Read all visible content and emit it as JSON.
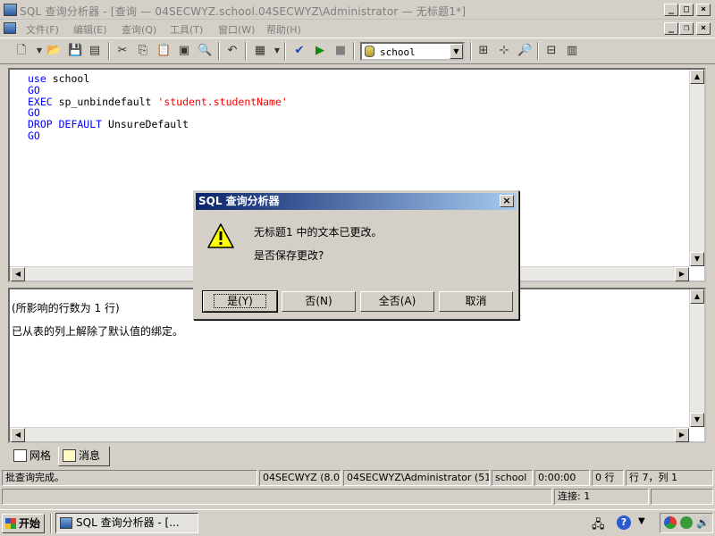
{
  "window": {
    "title": "SQL 查询分析器 - [查询 — 04SECWYZ.school.04SECWYZ\\Administrator — 无标题1*]",
    "min": "_",
    "max": "□",
    "close": "×"
  },
  "menu": {
    "items": [
      "文件(F)",
      "编辑(E)",
      "查询(Q)",
      "工具(T)",
      "窗口(W)",
      "帮助(H)"
    ]
  },
  "toolbar": {
    "database": "school"
  },
  "editor": {
    "lines": [
      {
        "kw": "use",
        "rest": " school",
        "str": ""
      },
      {
        "kw": "GO",
        "rest": "",
        "str": ""
      },
      {
        "kw": "EXEC",
        "rest": " sp_unbindefault ",
        "str": "'student.studentName'"
      },
      {
        "kw": "GO",
        "rest": "",
        "str": ""
      },
      {
        "kw": "DROP DEFAULT",
        "rest": " UnsureDefault",
        "str": ""
      },
      {
        "kw": "GO",
        "rest": "",
        "str": ""
      }
    ]
  },
  "results": {
    "lines": [
      "(所影响的行数为 1 行)",
      "已从表的列上解除了默认值的绑定。"
    ]
  },
  "tabs": [
    {
      "label": "网格"
    },
    {
      "label": "消息"
    }
  ],
  "status": {
    "message": "批查询完成。",
    "server": "04SECWYZ (8.0)",
    "user": "04SECWYZ\\Administrator (51",
    "db": "school",
    "time": "0:00:00",
    "rows": "0 行",
    "position": "行 7，列 1",
    "connections": "连接: 1"
  },
  "taskbar": {
    "start": "开始",
    "task": "SQL 查询分析器 - [..."
  },
  "dialog": {
    "title": "SQL 查询分析器",
    "line1": "无标题1 中的文本已更改。",
    "line2": "是否保存更改?",
    "yes": "是(Y)",
    "no": "否(N)",
    "no_all": "全否(A)",
    "cancel": "取消",
    "close": "×"
  }
}
